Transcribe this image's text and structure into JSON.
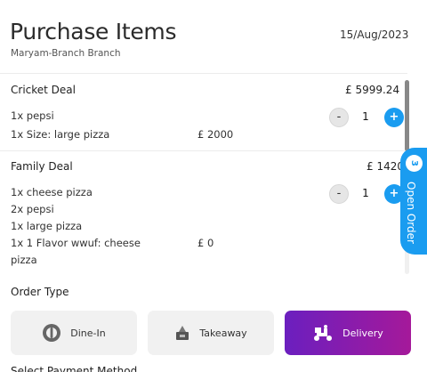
{
  "header": {
    "title": "Purchase Items",
    "date": "15/Aug/2023",
    "branch": "Maryam-Branch Branch"
  },
  "deals": [
    {
      "name": "Cricket Deal",
      "price": "£ 5999.24",
      "items": [
        "1x pepsi",
        "1x Size: large pizza"
      ],
      "subprice": "£ 2000",
      "qty": "1"
    },
    {
      "name": "Family Deal",
      "price": "£ 1420",
      "items": [
        "1x cheese pizza",
        "2x pepsi",
        "1x large pizza",
        "1x 1 Flavor wwuf: cheese",
        "pizza"
      ],
      "subprice": "£ 0",
      "qty": "1"
    }
  ],
  "qty_controls": {
    "minus": "-",
    "plus": "+"
  },
  "open_order": {
    "count": "3",
    "label": "Open Order"
  },
  "order_type": {
    "label": "Order Type",
    "options": [
      "Dine-In",
      "Takeaway",
      "Delivery"
    ],
    "selected": "Delivery"
  },
  "next_section": "Select Payment Method",
  "colors": {
    "accent_blue": "#1a9cf0",
    "delivery_gradient_start": "#6b1fbf",
    "delivery_gradient_end": "#a5199a"
  }
}
